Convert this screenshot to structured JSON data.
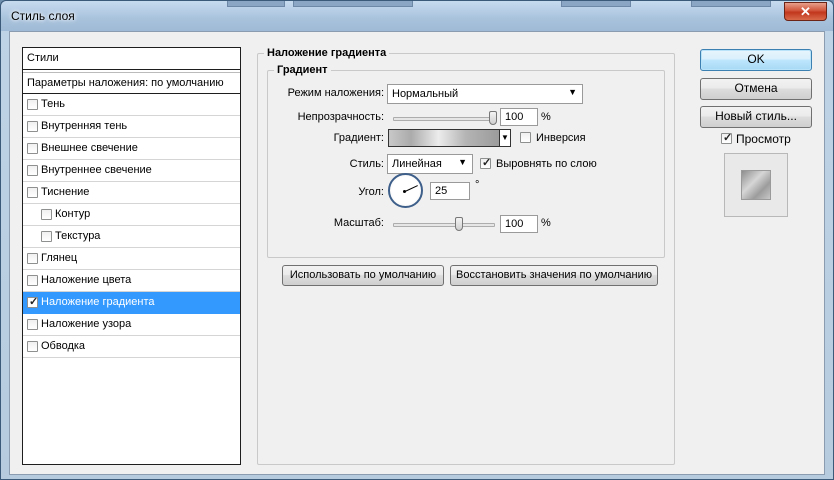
{
  "window": {
    "title": "Стиль слоя",
    "close_label": "✕"
  },
  "styles_list": {
    "header": "Стили",
    "blend_options": "Параметры наложения: по умолчанию",
    "items": [
      {
        "label": "Тень",
        "checked": false,
        "sub": false,
        "selected": false
      },
      {
        "label": "Внутренняя тень",
        "checked": false,
        "sub": false,
        "selected": false
      },
      {
        "label": "Внешнее свечение",
        "checked": false,
        "sub": false,
        "selected": false
      },
      {
        "label": "Внутреннее свечение",
        "checked": false,
        "sub": false,
        "selected": false
      },
      {
        "label": "Тиснение",
        "checked": false,
        "sub": false,
        "selected": false
      },
      {
        "label": "Контур",
        "checked": false,
        "sub": true,
        "selected": false
      },
      {
        "label": "Текстура",
        "checked": false,
        "sub": true,
        "selected": false
      },
      {
        "label": "Глянец",
        "checked": false,
        "sub": false,
        "selected": false
      },
      {
        "label": "Наложение цвета",
        "checked": false,
        "sub": false,
        "selected": false
      },
      {
        "label": "Наложение градиента",
        "checked": true,
        "sub": false,
        "selected": true
      },
      {
        "label": "Наложение узора",
        "checked": false,
        "sub": false,
        "selected": false
      },
      {
        "label": "Обводка",
        "checked": false,
        "sub": false,
        "selected": false
      }
    ]
  },
  "panel": {
    "outer_title": "Наложение градиента",
    "inner_title": "Градиент",
    "blend_mode_label": "Режим наложения:",
    "blend_mode_value": "Нормальный",
    "opacity_label": "Непрозрачность:",
    "opacity_value": "100",
    "opacity_unit": "%",
    "opacity_fraction": 1.0,
    "gradient_label": "Градиент:",
    "reverse_label": "Инверсия",
    "reverse_checked": false,
    "style_label": "Стиль:",
    "style_value": "Линейная",
    "align_label": "Выровнять по слою",
    "align_checked": true,
    "angle_label": "Угол:",
    "angle_value": "25",
    "angle_unit": "°",
    "scale_label": "Масштаб:",
    "scale_value": "100",
    "scale_unit": "%",
    "scale_fraction": 0.667,
    "make_default_label": "Использовать по умолчанию",
    "reset_default_label": "Восстановить значения по умолчанию"
  },
  "buttons": {
    "ok_label": "OK",
    "cancel_label": "Отмена",
    "new_style_label": "Новый стиль...",
    "preview_label": "Просмотр",
    "preview_checked": true
  },
  "colors": {
    "selection": "#3399ff",
    "default_button_border": "#3c7fb1"
  }
}
